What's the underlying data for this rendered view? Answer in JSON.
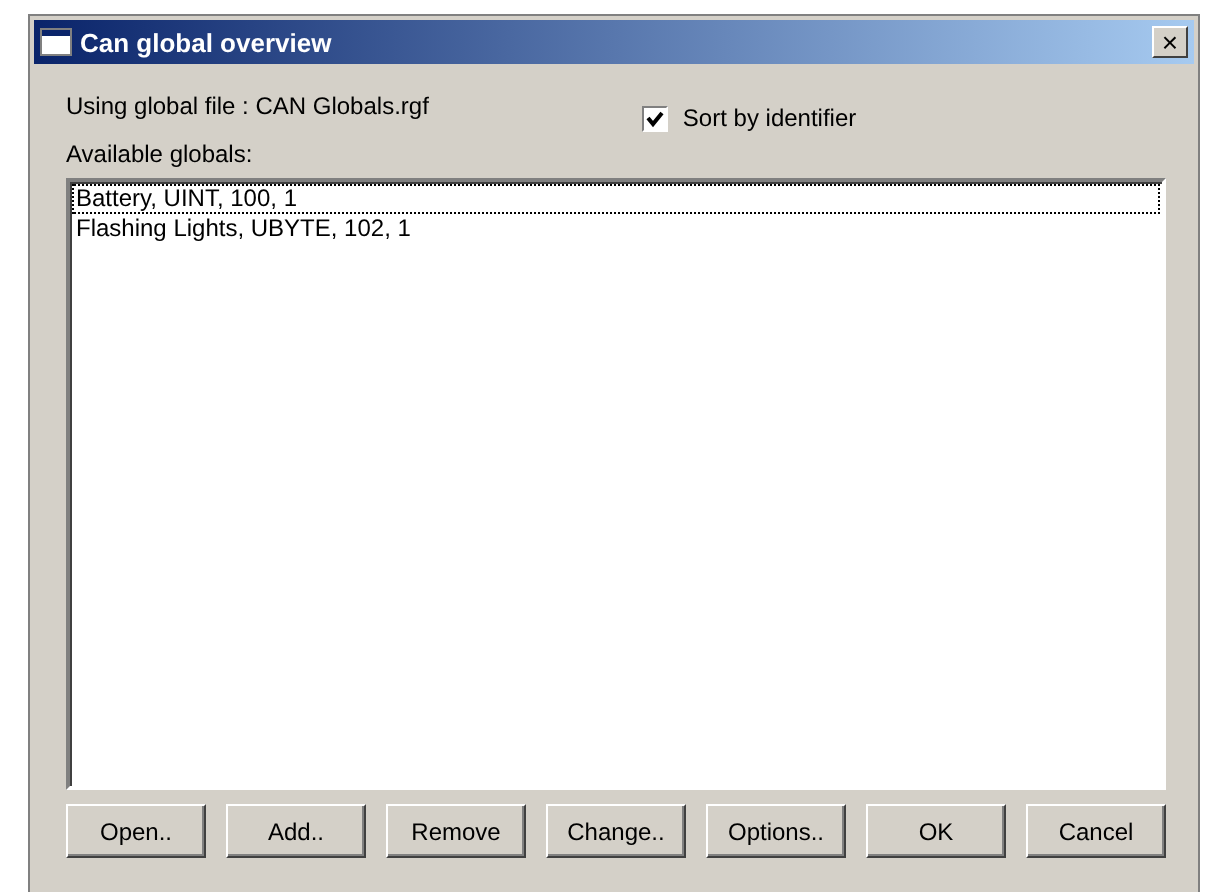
{
  "window": {
    "title": "Can global overview",
    "close": "×"
  },
  "file_label": "Using global file : CAN Globals.rgf",
  "sort_checkbox": {
    "label": "Sort by identifier",
    "checked": true
  },
  "list_label": "Available globals:",
  "globals": [
    {
      "text": "Battery, UINT, 100, 1",
      "selected": true
    },
    {
      "text": "Flashing Lights, UBYTE, 102, 1",
      "selected": false
    }
  ],
  "buttons": [
    "Open..",
    "Add..",
    "Remove",
    "Change..",
    "Options..",
    "OK",
    "Cancel"
  ]
}
